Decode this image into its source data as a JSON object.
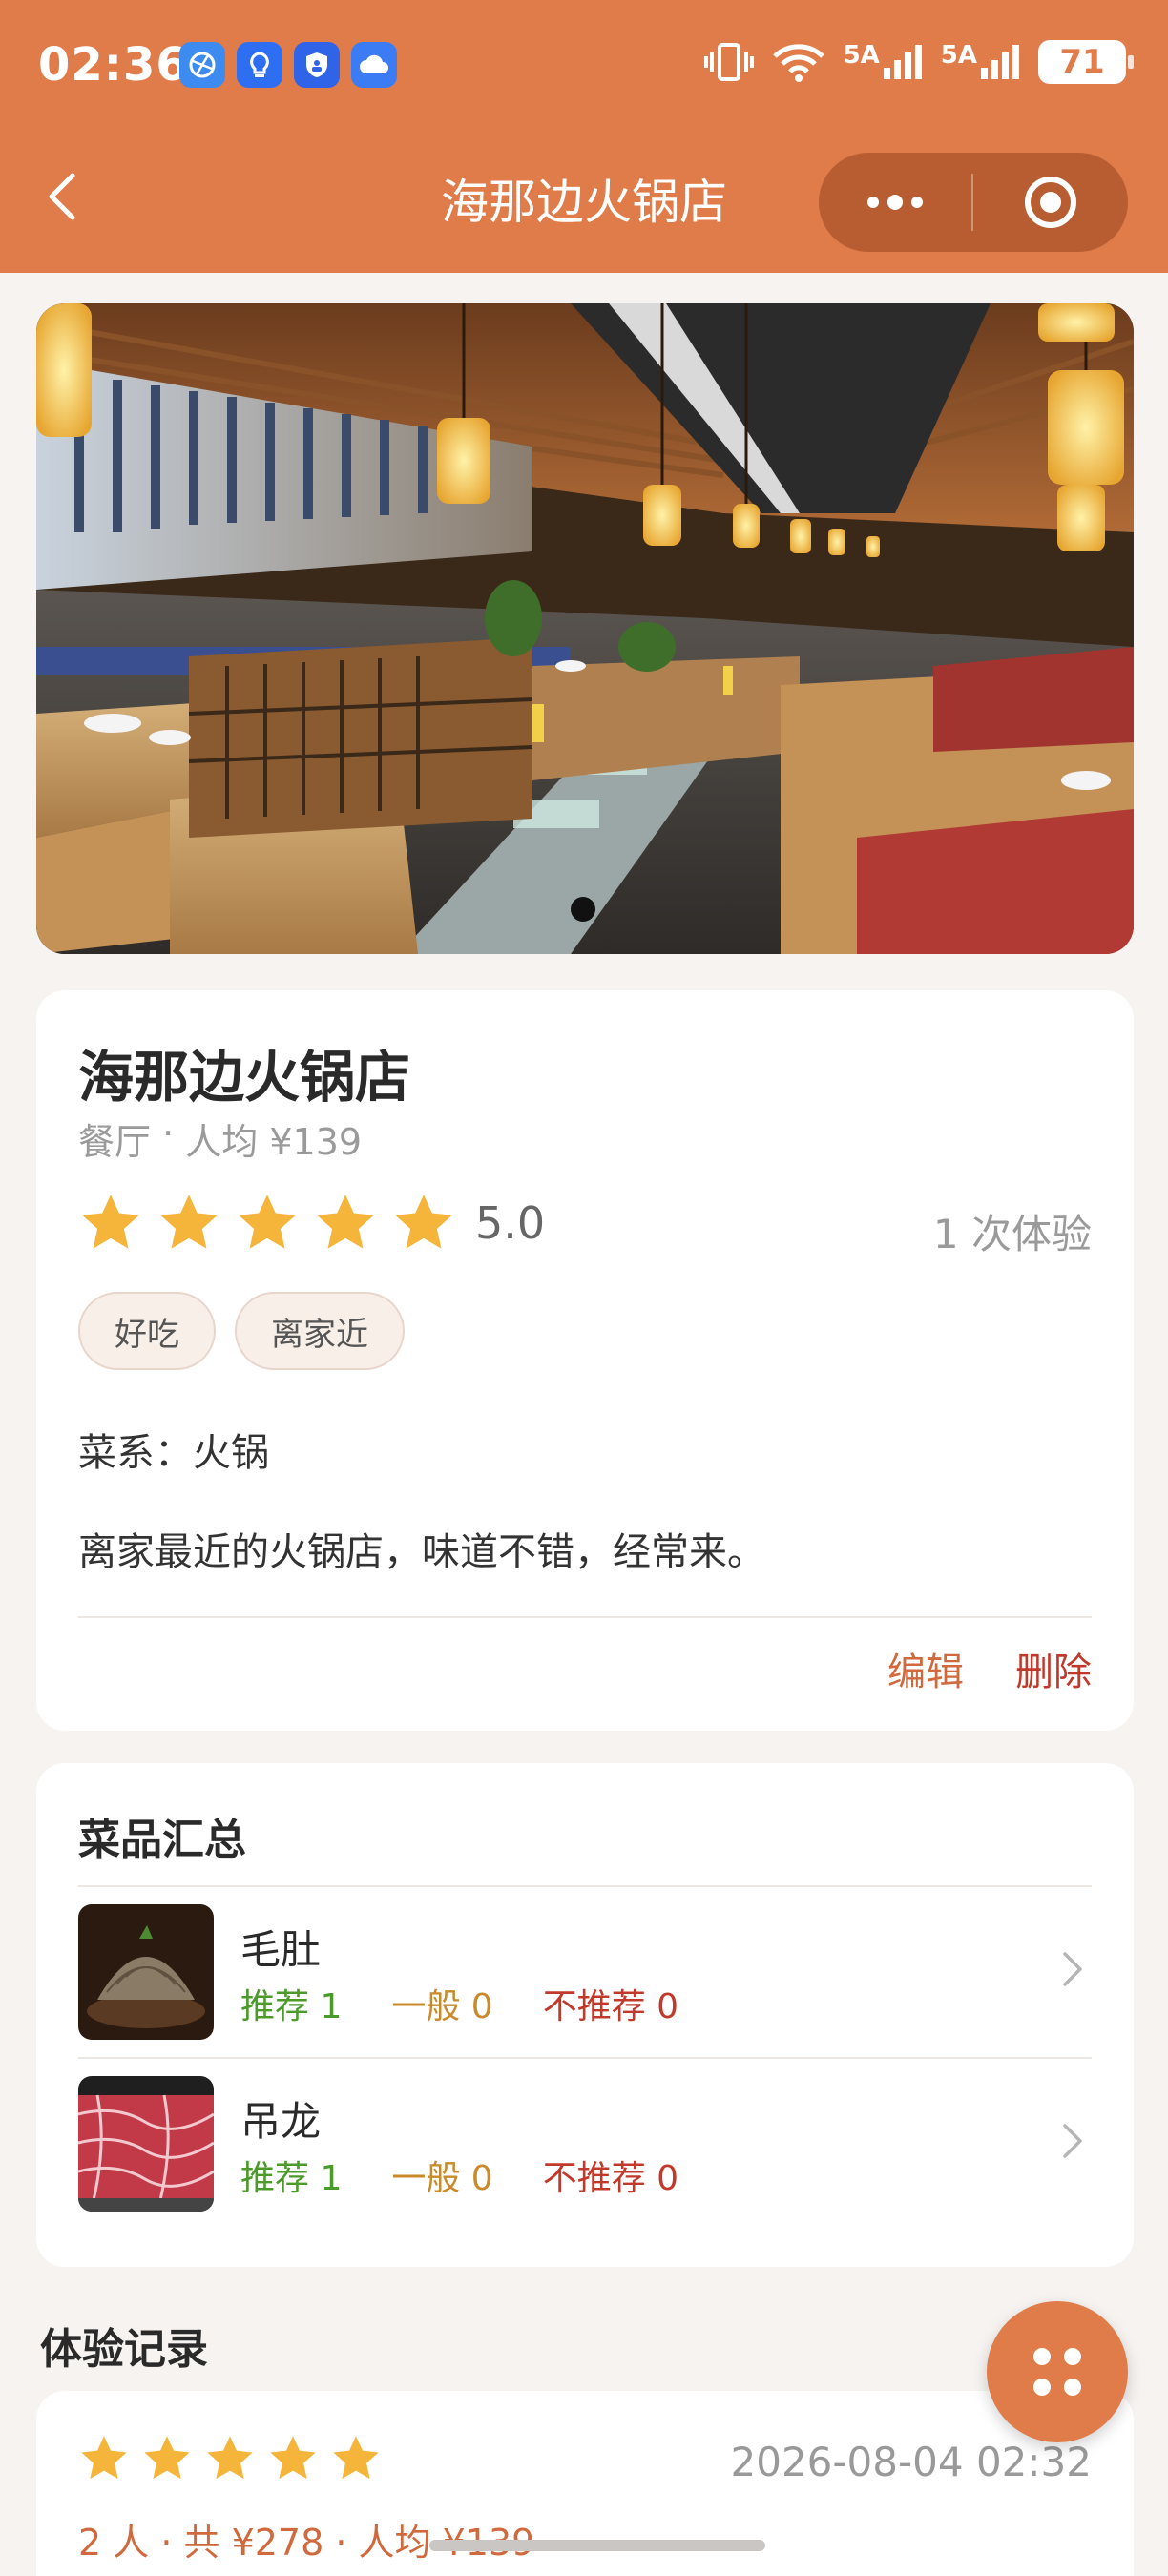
{
  "status_bar": {
    "time": "02:36",
    "network_1": "5A",
    "network_2": "5A",
    "battery": "71"
  },
  "nav": {
    "title": "海那边火锅店"
  },
  "restaurant": {
    "name": "海那边火锅店",
    "category": "餐厅",
    "separator": " · ",
    "avg_price": "人均 ¥139",
    "stars": 5,
    "rating": "5.0",
    "visits": "1 次体验",
    "tags": [
      "好吃",
      "离家近"
    ],
    "cuisine": "菜系：火锅",
    "note": "离家最近的火锅店，味道不错，经常来。",
    "edit_label": "编辑",
    "delete_label": "删除"
  },
  "dishes": {
    "title": "菜品汇总",
    "items": [
      {
        "name": "毛肚",
        "recommend": "推荐 1",
        "neutral": "一般 0",
        "not_recommend": "不推荐 0"
      },
      {
        "name": "吊龙",
        "recommend": "推荐 1",
        "neutral": "一般 0",
        "not_recommend": "不推荐 0"
      }
    ]
  },
  "records": {
    "title": "体验记录",
    "items": [
      {
        "stars": 5,
        "date": "2026-08-04 02:32",
        "summary": "2 人 · 共 ¥278 · 人均 ¥139"
      }
    ]
  },
  "colors": {
    "brand": "#e07b4a",
    "star": "#f5b43a",
    "recommend": "#4c9a2a",
    "neutral": "#c88a2a",
    "not_recommend": "#c0392b"
  },
  "icons": [
    "back-arrow-icon",
    "more-dots-icon",
    "record-target-icon",
    "star-icon",
    "chevron-right-icon",
    "grid-dots-icon"
  ]
}
